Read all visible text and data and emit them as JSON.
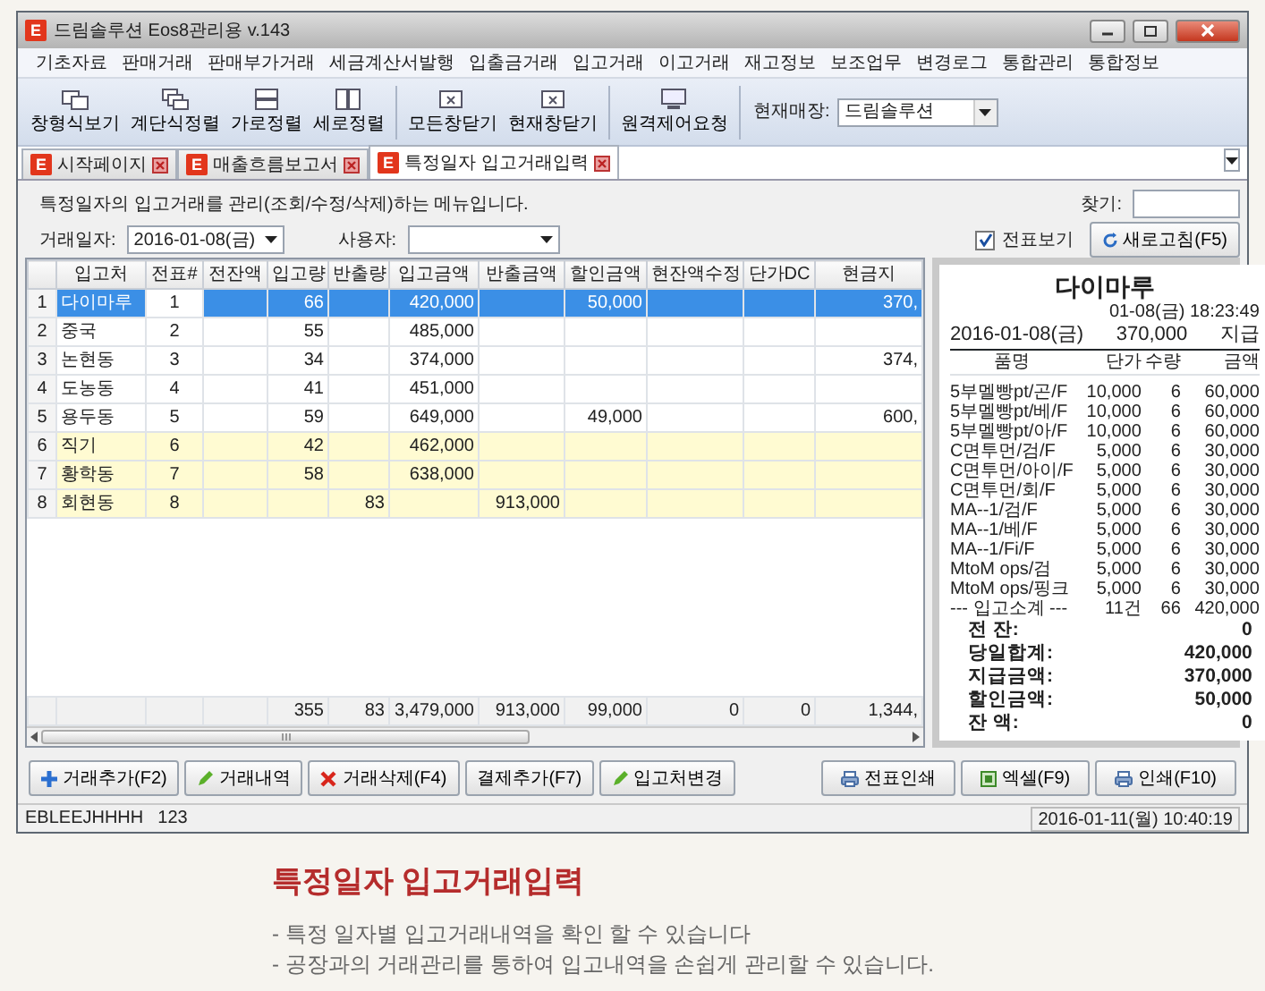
{
  "window": {
    "logo_letter": "E",
    "title": "드림솔루션 Eos8관리용 v.143"
  },
  "menu": [
    "기초자료",
    "판매거래",
    "판매부가거래",
    "세금계산서발행",
    "입출금거래",
    "입고거래",
    "이고거래",
    "재고정보",
    "보조업무",
    "변경로그",
    "통합관리",
    "통합정보"
  ],
  "toolbar": {
    "groups": [
      [
        "창형식보기",
        "계단식정렬",
        "가로정렬",
        "세로정렬"
      ],
      [
        "모든창닫기",
        "현재창닫기"
      ],
      [
        "원격제어요청"
      ]
    ],
    "store_label": "현재매장:",
    "store_value": "드림솔루션"
  },
  "tabs": [
    {
      "icon_letter": "E",
      "label": "시작페이지",
      "selected": false
    },
    {
      "icon_letter": "E",
      "label": "매출흐름보고서",
      "selected": false
    },
    {
      "icon_letter": "E",
      "label": "특정일자 입고거래입력",
      "selected": true
    }
  ],
  "description": "특정일자의 입고거래를 관리(조회/수정/삭제)하는 메뉴입니다.",
  "filters": {
    "find_label": "찾기:",
    "date_label": "거래일자:",
    "date_value": "2016-01-08(금)",
    "user_label": "사용자:"
  },
  "slip_view": {
    "label": "전표보기",
    "checked": true
  },
  "refresh_button": "새로고침(F5)",
  "grid": {
    "columns": [
      "입고처",
      "전표#",
      "전잔액",
      "입고량",
      "반출량",
      "입고금액",
      "반출금액",
      "할인금액",
      "현잔액수정",
      "단가DC",
      "현금지"
    ],
    "rows": [
      {
        "no": "1",
        "cells": [
          "다이마루",
          "1",
          null,
          "66",
          null,
          "420,000",
          null,
          "50,000",
          null,
          null,
          "370,"
        ],
        "selected": true,
        "highlighted": false
      },
      {
        "no": "2",
        "cells": [
          "중국",
          "2",
          null,
          "55",
          null,
          "485,000",
          null,
          null,
          null,
          null,
          null
        ],
        "selected": false,
        "highlighted": false
      },
      {
        "no": "3",
        "cells": [
          "논현동",
          "3",
          null,
          "34",
          null,
          "374,000",
          null,
          null,
          null,
          null,
          "374,"
        ],
        "selected": false,
        "highlighted": false
      },
      {
        "no": "4",
        "cells": [
          "도농동",
          "4",
          null,
          "41",
          null,
          "451,000",
          null,
          null,
          null,
          null,
          null
        ],
        "selected": false,
        "highlighted": false
      },
      {
        "no": "5",
        "cells": [
          "용두동",
          "5",
          null,
          "59",
          null,
          "649,000",
          null,
          "49,000",
          null,
          null,
          "600,"
        ],
        "selected": false,
        "highlighted": false
      },
      {
        "no": "6",
        "cells": [
          "직기",
          "6",
          null,
          "42",
          null,
          "462,000",
          null,
          null,
          null,
          null,
          null
        ],
        "selected": false,
        "highlighted": true
      },
      {
        "no": "7",
        "cells": [
          "황학동",
          "7",
          null,
          "58",
          null,
          "638,000",
          null,
          null,
          null,
          null,
          null
        ],
        "selected": false,
        "highlighted": true
      },
      {
        "no": "8",
        "cells": [
          "회현동",
          "8",
          null,
          null,
          "83",
          null,
          "913,000",
          null,
          null,
          null,
          null
        ],
        "selected": false,
        "highlighted": true
      }
    ],
    "totals": [
      "355",
      "83",
      "3,479,000",
      "913,000",
      "99,000",
      "0",
      "0",
      "1,344,"
    ]
  },
  "receipt": {
    "title": "다이마루",
    "time": "01-08(금) 18:23:49",
    "date": "2016-01-08(금)",
    "amount": "370,000",
    "type": "지급",
    "columns": [
      "품명",
      "단가",
      "수량",
      "금액"
    ],
    "items": [
      [
        "5부멜빵pt/곤/F",
        "10,000",
        "6",
        "60,000"
      ],
      [
        "5부멜빵pt/베/F",
        "10,000",
        "6",
        "60,000"
      ],
      [
        "5부멜빵pt/아/F",
        "10,000",
        "6",
        "60,000"
      ],
      [
        "C면투먼/검/F",
        "5,000",
        "6",
        "30,000"
      ],
      [
        "C면투먼/아이/F",
        "5,000",
        "6",
        "30,000"
      ],
      [
        "C면투먼/회/F",
        "5,000",
        "6",
        "30,000"
      ],
      [
        "MA--1/검/F",
        "5,000",
        "6",
        "30,000"
      ],
      [
        "MA--1/베/F",
        "5,000",
        "6",
        "30,000"
      ],
      [
        "MA--1/Fi/F",
        "5,000",
        "6",
        "30,000"
      ],
      [
        "MtoM ops/검",
        "5,000",
        "6",
        "30,000"
      ],
      [
        "MtoM ops/핑크",
        "5,000",
        "6",
        "30,000"
      ]
    ],
    "subtotal": [
      "--- 입고소계 ---",
      "11건",
      "66",
      "420,000"
    ],
    "summary": [
      [
        "전 잔:",
        "0"
      ],
      [
        "당일합계:",
        "420,000"
      ],
      [
        "지급금액:",
        "370,000"
      ],
      [
        "할인금액:",
        "50,000"
      ],
      [
        "잔 액:",
        "0"
      ]
    ]
  },
  "buttons": [
    {
      "label": "거래추가(F2)",
      "kind": "add"
    },
    {
      "label": "거래내역",
      "kind": "edit"
    },
    {
      "label": "거래삭제(F4)",
      "kind": "delete"
    },
    {
      "label": "결제추가(F7)",
      "kind": "plain"
    },
    {
      "label": "입고처변경",
      "kind": "edit"
    }
  ],
  "right_buttons": [
    {
      "label": "전표인쇄",
      "kind": "print"
    },
    {
      "label": "엑셀(F9)",
      "kind": "excel"
    },
    {
      "label": "인쇄(F10)",
      "kind": "print"
    }
  ],
  "status_bar": {
    "user": "EBLEEJHHHH",
    "code": "123",
    "datetime": "2016-01-11(월) 10:40:19"
  },
  "caption": {
    "title": "특정일자 입고거래입력",
    "lines": [
      "- 특정 일자별 입고거래내역을 확인 할 수 있습니다",
      "- 공장과의 거래관리를 통하여 입고내역을 손쉽게 관리할 수 있습니다."
    ]
  }
}
